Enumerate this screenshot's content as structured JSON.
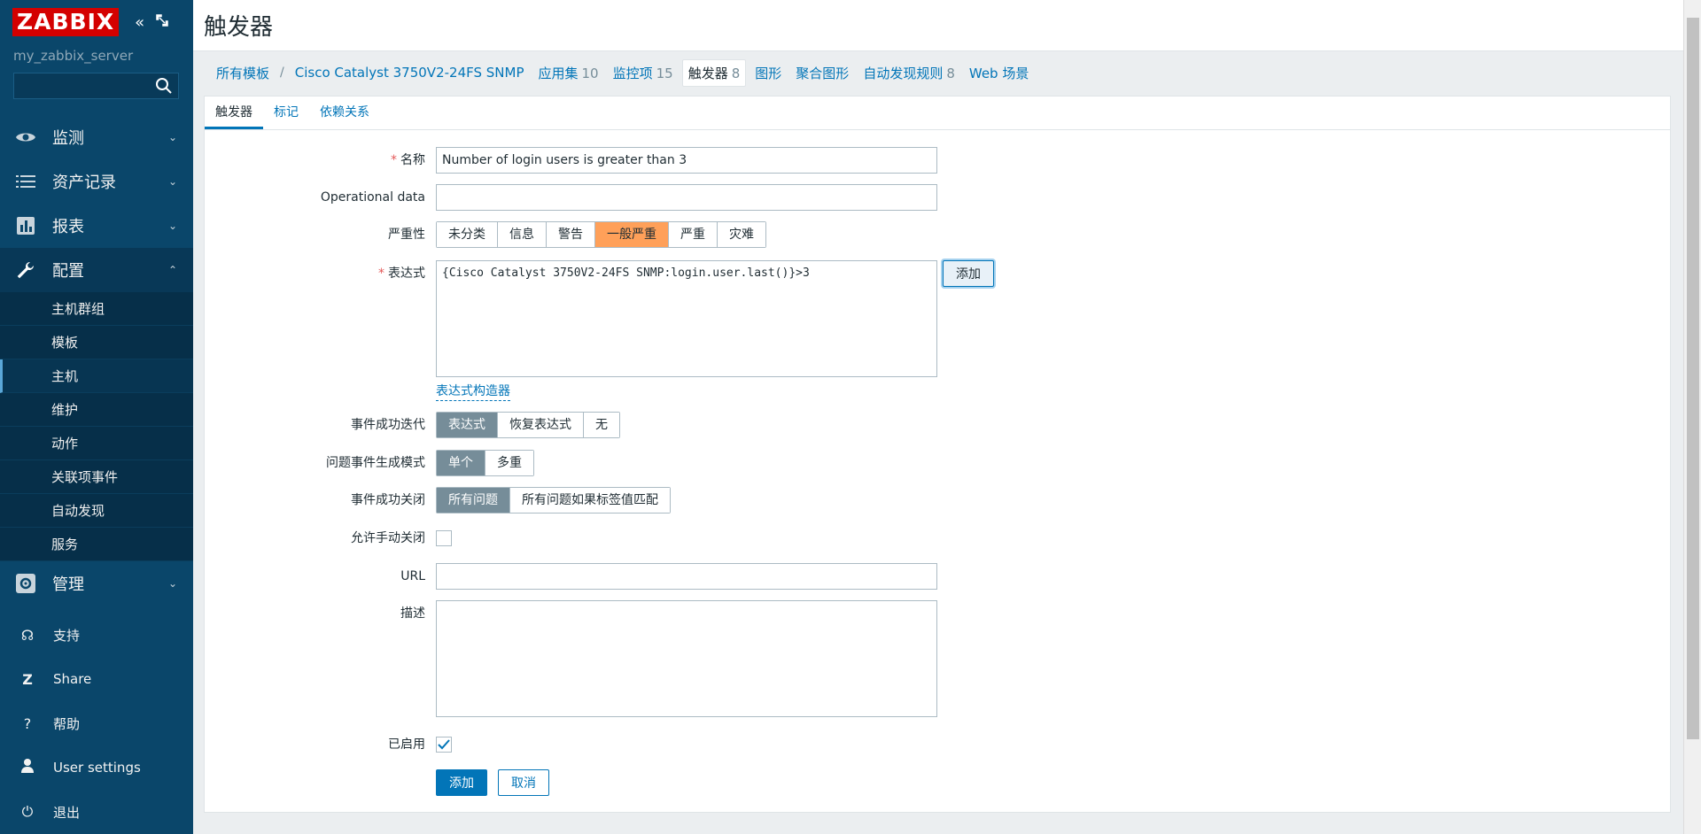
{
  "sidebar": {
    "logo": "ZABBIX",
    "server": "my_zabbix_server",
    "search_placeholder": "",
    "menu": [
      {
        "label": "监测"
      },
      {
        "label": "资产记录"
      },
      {
        "label": "报表"
      },
      {
        "label": "配置"
      },
      {
        "label": "管理"
      }
    ],
    "config_sub": [
      "主机群组",
      "模板",
      "主机",
      "维护",
      "动作",
      "关联项事件",
      "自动发现",
      "服务"
    ],
    "bottom": [
      "支持",
      "Share",
      "帮助",
      "User settings",
      "退出"
    ]
  },
  "header": {
    "title": "触发器"
  },
  "breadcrumb": {
    "all_templates": "所有模板",
    "template": "Cisco Catalyst 3750V2-24FS SNMP",
    "apps": "应用集",
    "apps_count": "10",
    "items": "监控项",
    "items_count": "15",
    "triggers": "触发器",
    "triggers_count": "8",
    "graphs": "图形",
    "screens": "聚合图形",
    "discovery": "自动发现规则",
    "discovery_count": "8",
    "web": "Web 场景"
  },
  "tabs": [
    "触发器",
    "标记",
    "依赖关系"
  ],
  "form": {
    "name_label": "名称",
    "name_value": "Number of login users is greater than 3",
    "opdata_label": "Operational data",
    "opdata_value": "",
    "severity_label": "严重性",
    "severities": [
      "未分类",
      "信息",
      "警告",
      "一般严重",
      "严重",
      "灾难"
    ],
    "severity_selected": "一般严重",
    "expr_label": "表达式",
    "expr_value": "{Cisco Catalyst 3750V2-24FS SNMP:login.user.last()}>3",
    "expr_add_button": "添加",
    "expr_builder_link": "表达式构造器",
    "ok_event_label": "事件成功迭代",
    "ok_event_options": [
      "表达式",
      "恢复表达式",
      "无"
    ],
    "problem_mode_label": "问题事件生成模式",
    "problem_mode_options": [
      "单个",
      "多重"
    ],
    "ok_close_label": "事件成功关闭",
    "ok_close_options": [
      "所有问题",
      "所有问题如果标签值匹配"
    ],
    "manual_close_label": "允许手动关闭",
    "url_label": "URL",
    "url_value": "",
    "desc_label": "描述",
    "desc_value": "",
    "enabled_label": "已启用",
    "add_button": "添加",
    "cancel_button": "取消"
  },
  "colors": {
    "sidebar": "#0a466a",
    "accent": "#0275b8",
    "severity_average": "#ffa059",
    "logo": "#d40000"
  }
}
